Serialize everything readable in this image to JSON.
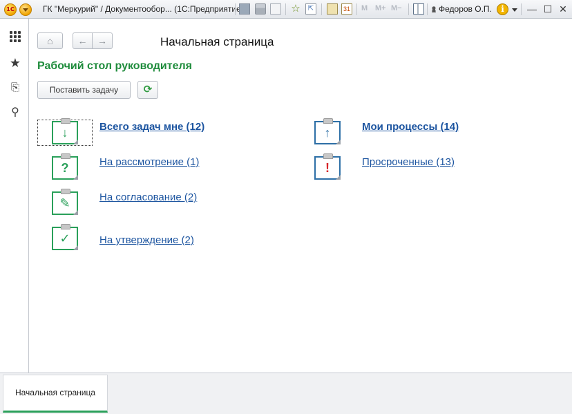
{
  "titlebar": {
    "logo": "1С",
    "title": "ГК \"Меркурий\" / Документообор...  (1С:Предприятие)",
    "memory_buttons": [
      "M",
      "M+",
      "M−"
    ],
    "user": "Федоров О.П.",
    "info_glyph": "i",
    "window_controls": {
      "minimize": "—",
      "maximize": "☐",
      "close": "✕"
    },
    "icons": [
      "save-icon",
      "print-icon",
      "preview-icon",
      "add-favorite-icon",
      "link-icon",
      "calculator-icon",
      "calendar-icon",
      "panel-icon",
      "user-icon",
      "info-icon"
    ],
    "calendar_label": "31"
  },
  "leftpanel": {
    "icons": [
      "sections-grid-icon",
      "favorites-star-icon",
      "history-icon",
      "search-icon"
    ],
    "glyphs": {
      "star": "★",
      "history": "⎘",
      "search": "⚲"
    }
  },
  "main": {
    "nav": {
      "home": "⌂",
      "back": "←",
      "forward": "→"
    },
    "page_title": "Начальная страница",
    "form_title": "Рабочий стол руководителя",
    "create_task_label": "Поставить задачу",
    "refresh_glyph": "⟳",
    "tasks_left": [
      {
        "label": "Всего задач мне (12)",
        "glyph": "↓",
        "bold": true,
        "icon": "arrow-down-clipboard-icon"
      },
      {
        "label": "На рассмотрение (1)",
        "glyph": "?",
        "bold": false,
        "icon": "question-clipboard-icon"
      },
      {
        "label": "На согласование (2)",
        "glyph": "✎",
        "bold": false,
        "icon": "pencil-clipboard-icon"
      },
      {
        "label": "На утверждение (2)",
        "glyph": "✓",
        "bold": false,
        "icon": "check-clipboard-icon"
      }
    ],
    "tasks_right": [
      {
        "label": "Мои процессы (14)",
        "glyph": "↑",
        "bold": true,
        "icon": "arrow-up-clipboard-icon"
      },
      {
        "label": "Просроченные (13)",
        "glyph": "!",
        "bold": false,
        "icon": "exclamation-clipboard-icon"
      }
    ]
  },
  "bottombar": {
    "open_tabs": [
      "Начальная страница"
    ]
  },
  "colors": {
    "accent_green": "#2aa05a",
    "form_title_green": "#1f8c3c",
    "link_blue": "#1d55a0",
    "process_blue": "#2d6fa6",
    "overdue_red": "#d7262a"
  }
}
